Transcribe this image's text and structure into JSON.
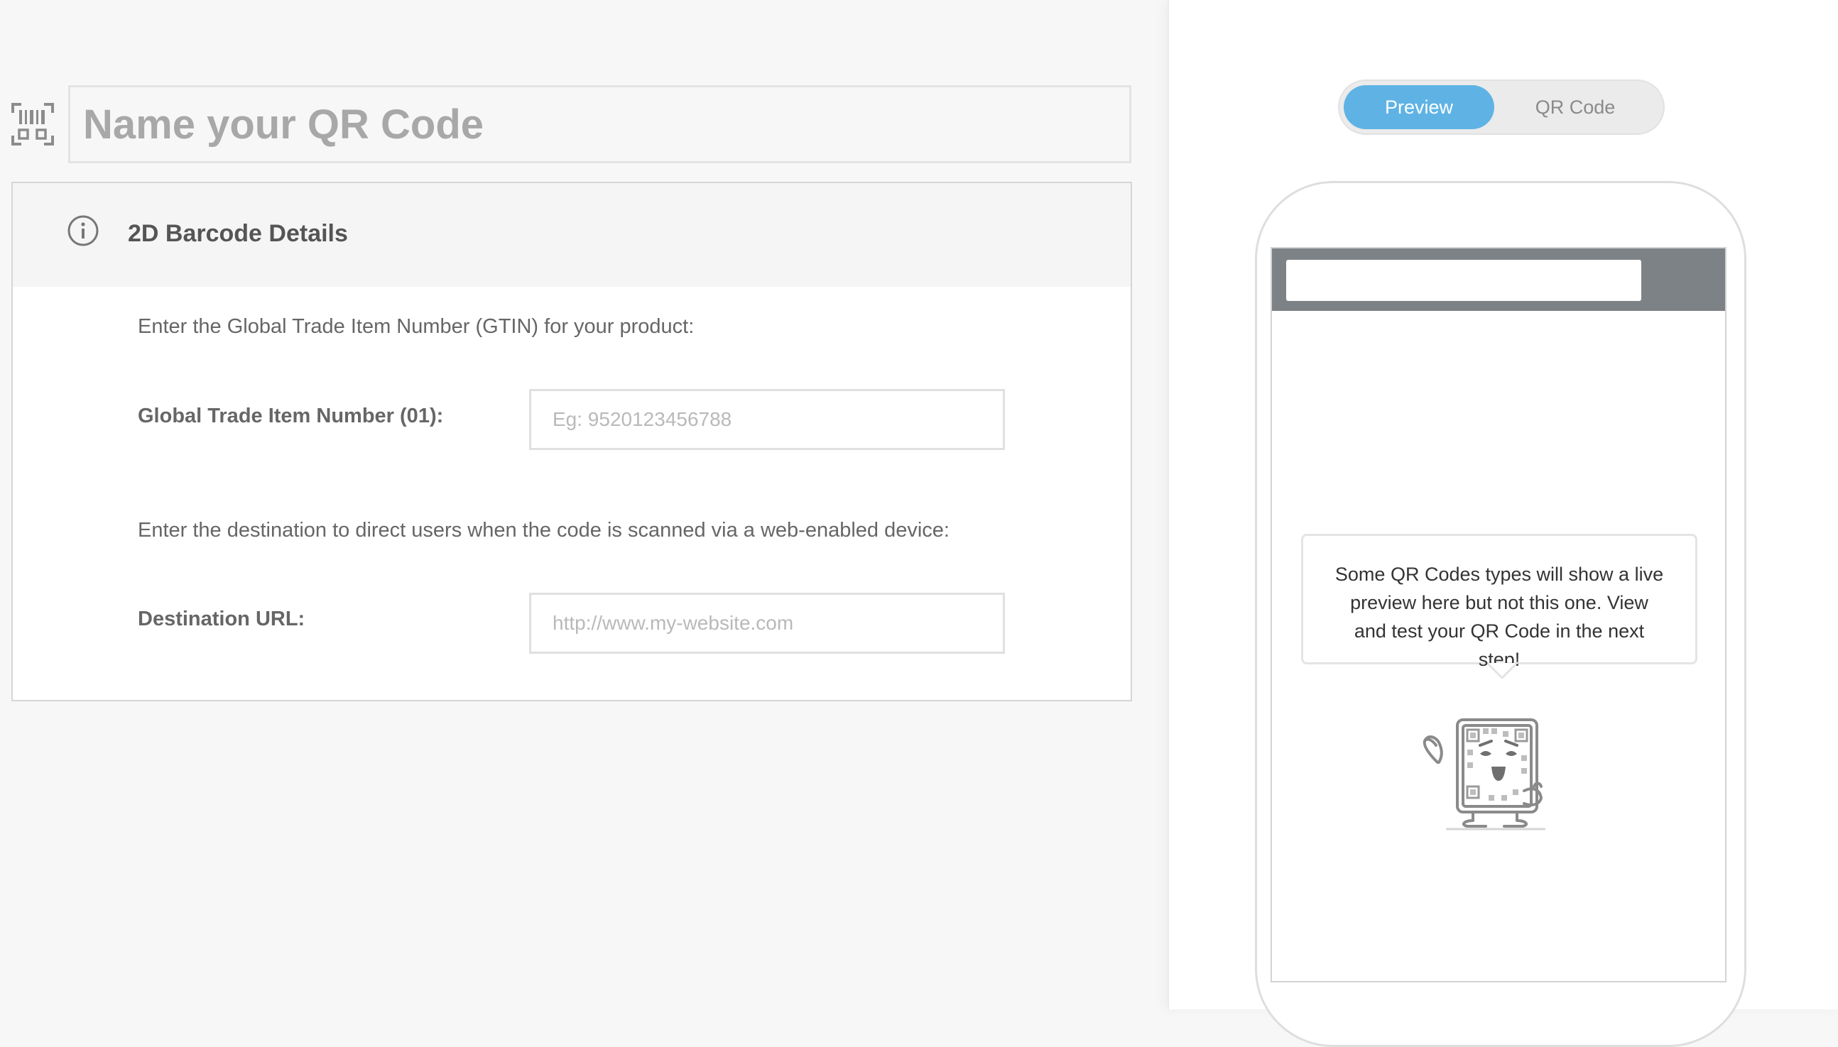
{
  "form": {
    "name_placeholder": "Name your QR Code"
  },
  "details": {
    "title": "2D Barcode Details",
    "gtin_prompt": "Enter the Global Trade Item Number (GTIN) for your product:",
    "gtin_label": "Global Trade Item Number (01):",
    "gtin_placeholder": "Eg: 9520123456788",
    "dest_prompt": "Enter the destination to direct users when the code is scanned via a web-enabled device:",
    "dest_label": "Destination URL:",
    "dest_placeholder": "http://www.my-website.com"
  },
  "preview": {
    "toggle_preview": "Preview",
    "toggle_qr": "QR Code",
    "bubble_text": "Some QR Codes types will show a live preview here but not this one. View and test your QR Code in the next step!"
  },
  "colors": {
    "accent": "#5fb3e4",
    "phone_bar": "#7d8286"
  },
  "icons": {
    "barcode": "barcode-icon",
    "info": "info-icon",
    "mascot": "qr-mascot-illustration"
  }
}
